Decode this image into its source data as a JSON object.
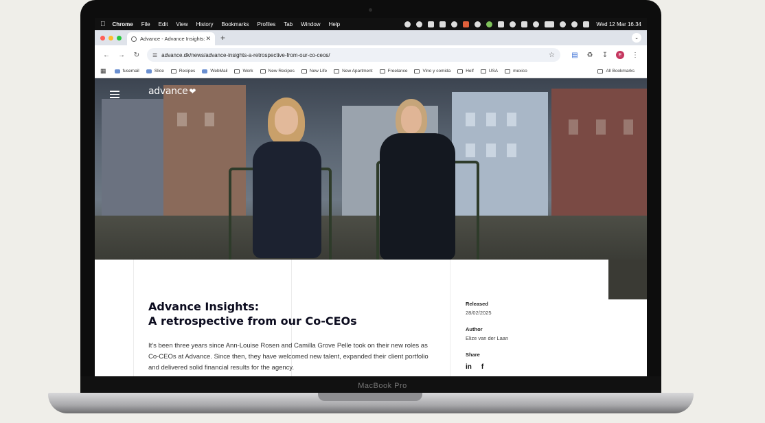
{
  "device": {
    "model_label": "MacBook Pro"
  },
  "menubar": {
    "app": "Chrome",
    "items": [
      "File",
      "Edit",
      "View",
      "History",
      "Bookmarks",
      "Profiles",
      "Tab",
      "Window",
      "Help"
    ],
    "clock": "Wed 12 Mar  16.34"
  },
  "browser": {
    "tab_title": "Advance - Advance Insights: A retrospective",
    "url": "advance.dk/news/advance-insights-a-retrospective-from-our-co-ceos/",
    "profile_initial": "E",
    "bookmarks": [
      "fusemail",
      "Slice",
      "Recipes",
      "WebMail",
      "Work",
      "New Recipes",
      "New Life",
      "New Apartment",
      "Freelance",
      "Vino y comida",
      "Helf",
      "USA",
      "mexico"
    ],
    "all_bookmarks": "All Bookmarks"
  },
  "site": {
    "logo": "advance",
    "headline_line1": "Advance Insights:",
    "headline_line2": "A retrospective from our Co-CEOs",
    "intro": "It's been three years since Ann-Louise Rosen and Camilla Grove Pelle took on their new roles as Co-CEOs at Advance. Since then, they have welcomed new talent, expanded their client portfolio and delivered solid financial results for the agency.",
    "released_label": "Released",
    "released_value": "28/02/2025",
    "author_label": "Author",
    "author_value": "Elize van der Laan",
    "share_label": "Share",
    "share_linkedin": "in",
    "share_facebook": "f"
  },
  "colors": {
    "accent_profile": "#c5365f",
    "headline": "#0b0b1e"
  }
}
